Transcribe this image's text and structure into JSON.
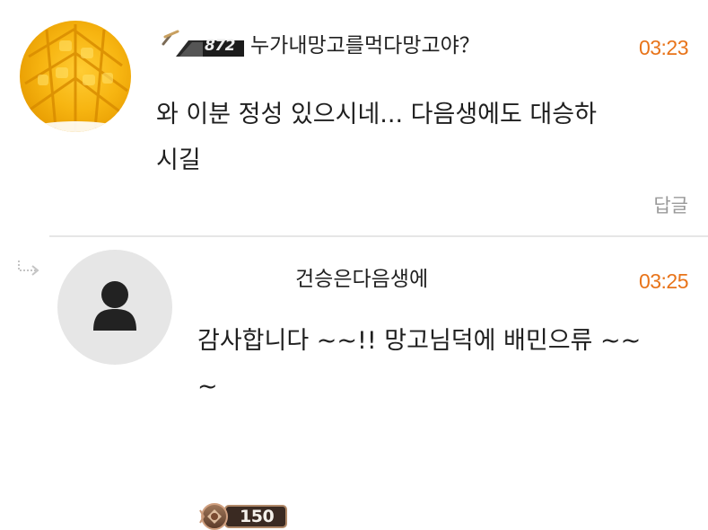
{
  "comments": [
    {
      "badge_level": "872",
      "nickname": "누가내망고를먹다망고야？",
      "time": "03:23",
      "text_lines": [
        "와 이분 정성 있으시네... 다음생에도 대승하",
        "시길"
      ],
      "reply_label": "답글",
      "avatar_icon": "mango-photo"
    },
    {
      "badge_level": "150",
      "nickname": "건승은다음생에",
      "time": "03:25",
      "text_lines": [
        "감사합니다 ~~!!  망고님덕에 배민으류 ~~",
        "~"
      ],
      "avatar_icon": "default-person-avatar"
    }
  ],
  "colors": {
    "time": "#e8741a",
    "reply_link": "#9a9a9a",
    "divider": "#e6e6e6"
  }
}
